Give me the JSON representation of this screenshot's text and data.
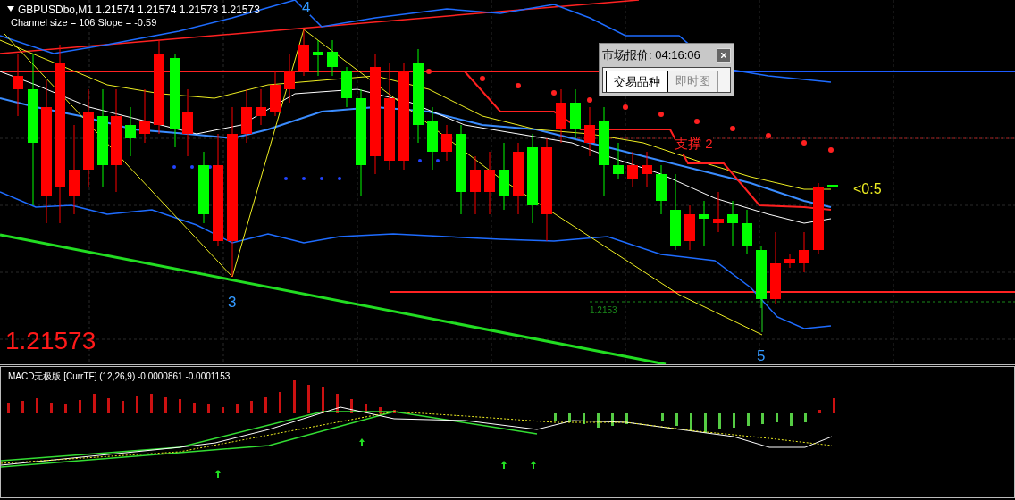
{
  "chart": {
    "symbol_header": "GBPUSDbo,M1  1.21574 1.21574 1.21573 1.21573",
    "indicator_info": "Channel size = 106 Slope = -0.59",
    "wave_labels": [
      "4",
      "3",
      "5"
    ],
    "support_label": "支撑 2",
    "arrow_label": "<0:5",
    "price_line_label": "1.2153",
    "current_price": "1.21573"
  },
  "quote_popup": {
    "title": "市场报价: 04:16:06",
    "tabs": [
      {
        "label": "交易品种",
        "selected": true
      },
      {
        "label": "即时图",
        "selected": false
      }
    ]
  },
  "macd": {
    "label": "MACD无极版 [CurrTF] (12,26,9) -0.0000861 -0.0001153"
  }
}
